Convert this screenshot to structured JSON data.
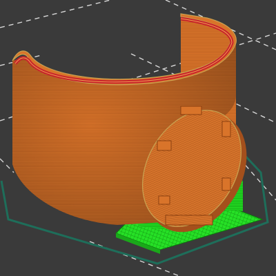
{
  "viewport": {
    "name": "3d-preview-viewport",
    "colors": {
      "background": "#3a3a3a",
      "grid_line": "#d8d8d8",
      "bed_outline": "#1e6e5a",
      "perimeter": "#d9742a",
      "perimeter_line": "#8a3f10",
      "inner_perimeter": "#c8232c",
      "support": "#22dd22",
      "support_line": "#0b7a0b",
      "top_edge": "#c8a050"
    },
    "objects": [
      {
        "name": "curved-shell-wall",
        "feature": "perimeter"
      },
      {
        "name": "round-disc-part",
        "feature": "perimeter"
      },
      {
        "name": "support-block",
        "feature": "support"
      },
      {
        "name": "skirt-outline",
        "feature": "skirt"
      }
    ]
  }
}
